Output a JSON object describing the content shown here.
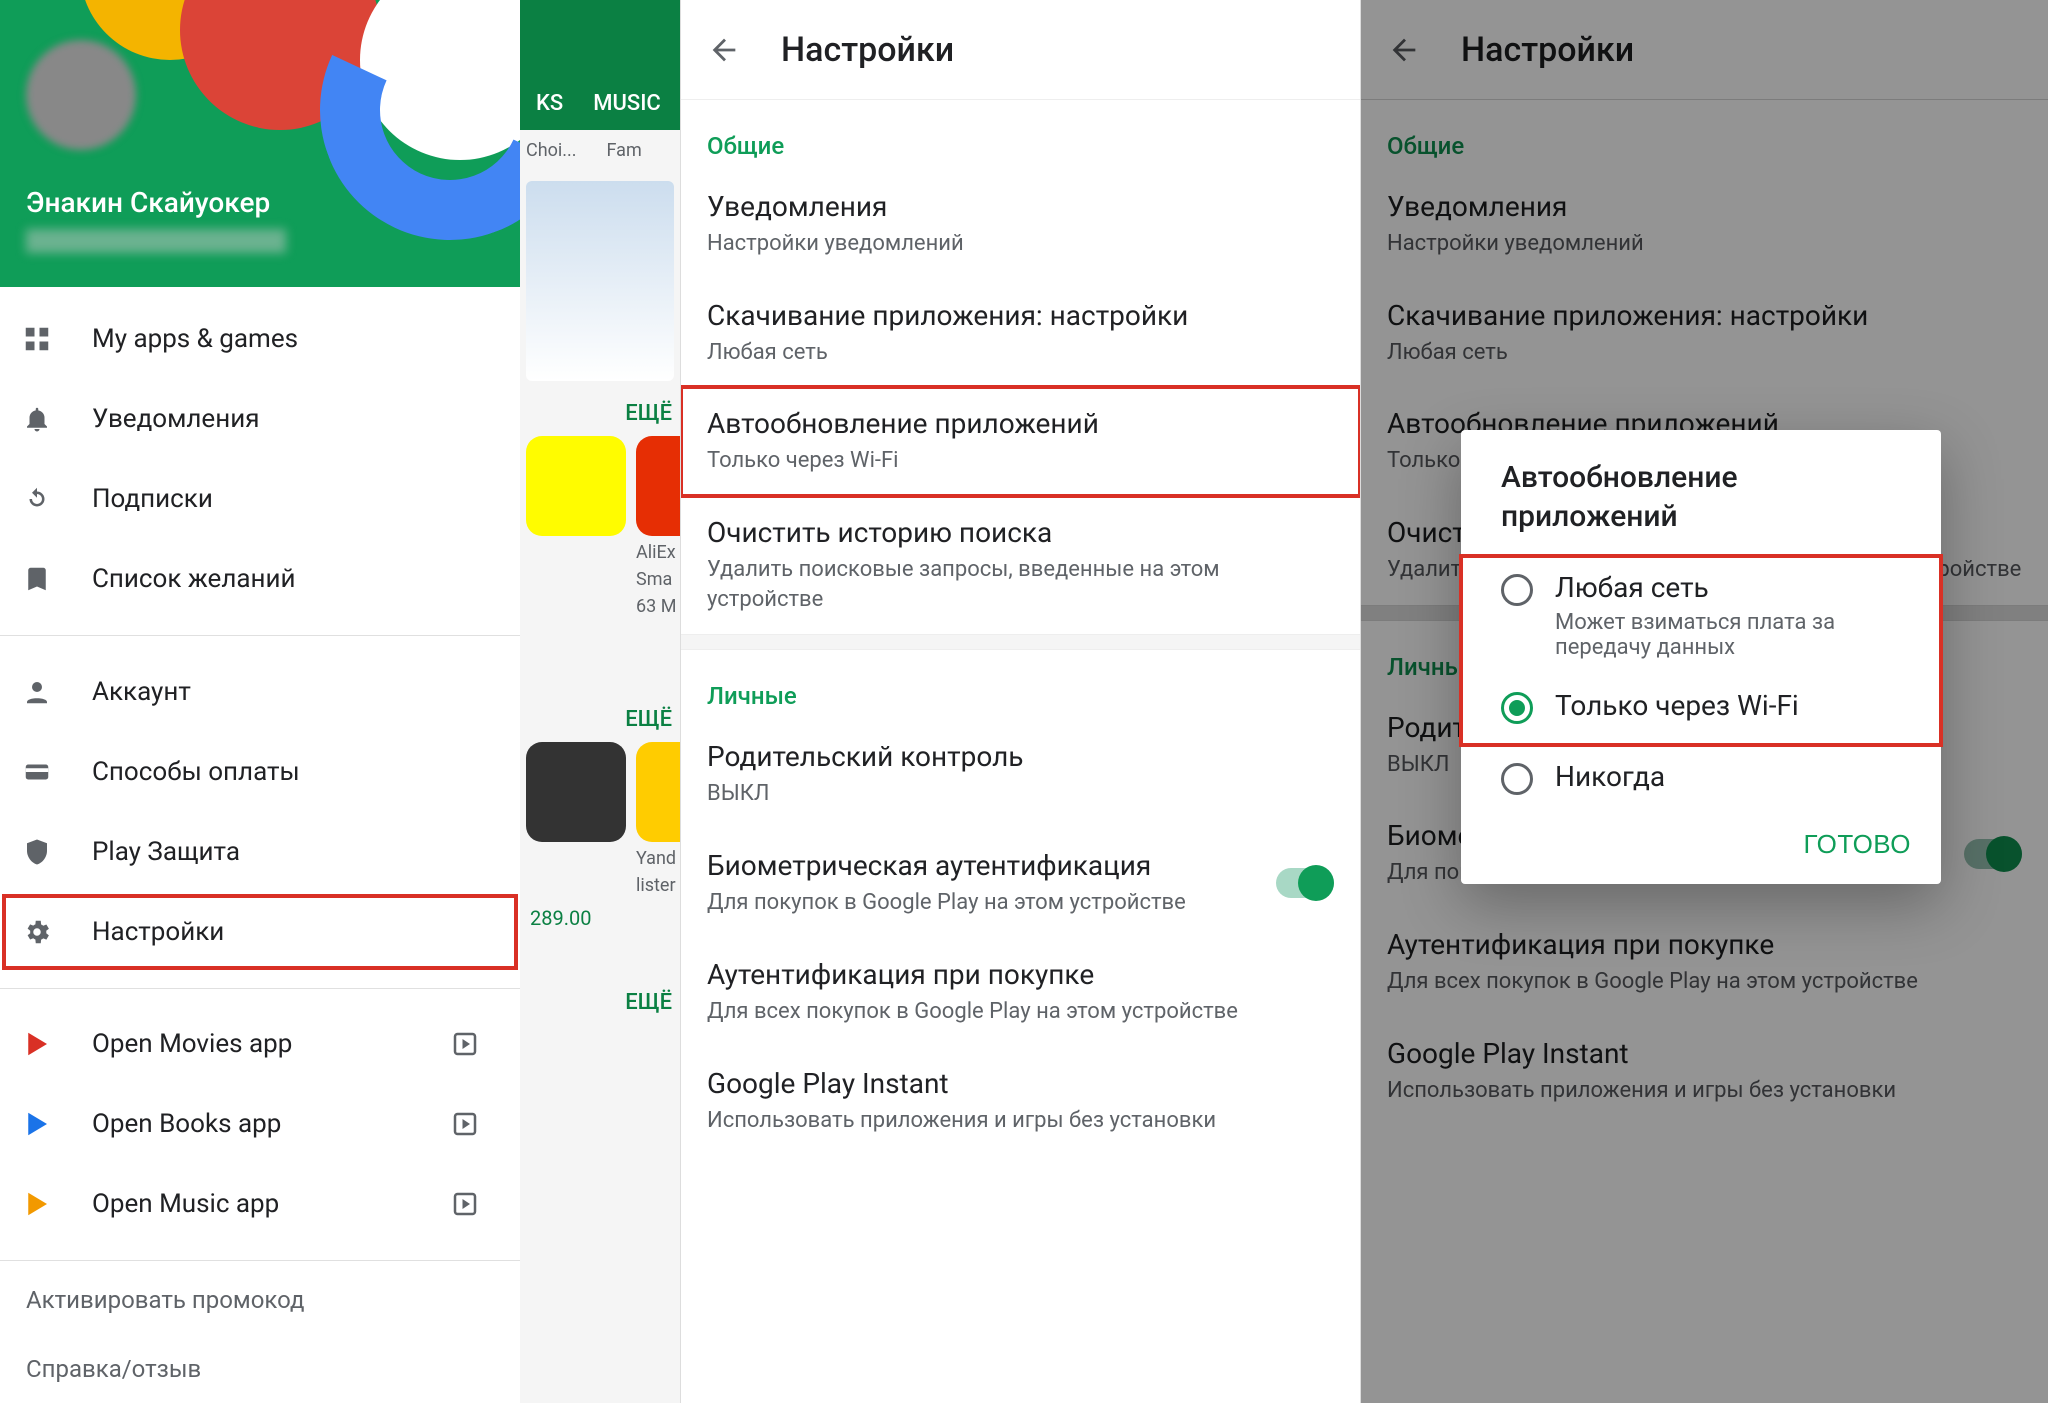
{
  "panel_a": {
    "user": {
      "name": "Энакин Скайуокер"
    },
    "nav_primary": [
      {
        "label": "My apps & games",
        "icon": "grid"
      },
      {
        "label": "Уведомления",
        "icon": "bell"
      },
      {
        "label": "Подписки",
        "icon": "refresh"
      },
      {
        "label": "Список желаний",
        "icon": "bookmark"
      }
    ],
    "nav_account": [
      {
        "label": "Аккаунт",
        "icon": "person"
      },
      {
        "label": "Способы оплаты",
        "icon": "card"
      },
      {
        "label": "Play Защита",
        "icon": "shield"
      },
      {
        "label": "Настройки",
        "icon": "gear",
        "highlight": true
      }
    ],
    "nav_open": [
      {
        "label": "Open Movies app",
        "color": "#d93025"
      },
      {
        "label": "Open Books app",
        "color": "#1a73e8"
      },
      {
        "label": "Open Music app",
        "color": "#f29900"
      }
    ],
    "promo": "Активировать промокод",
    "help": "Справка/отзыв",
    "play_bg": {
      "tabs": [
        "KS",
        "MUSIC"
      ],
      "choi": "Choi...",
      "fam": "Fam",
      "more": "ЕЩЁ",
      "apps": [
        {
          "name": "AliEx",
          "line2": "Sma",
          "line3": "63 M"
        },
        {
          "name": "Yand",
          "line2": "lister"
        }
      ],
      "price": "289.00"
    }
  },
  "settings": {
    "title": "Настройки",
    "section_general": "Общие",
    "rows_general": [
      {
        "title": "Уведомления",
        "sub": "Настройки уведомлений"
      },
      {
        "title": "Скачивание приложения: настройки",
        "sub": "Любая сеть"
      },
      {
        "title": "Автообновление приложений",
        "sub": "Только через Wi-Fi",
        "highlight": true
      },
      {
        "title": "Очистить историю поиска",
        "sub": "Удалить поисковые запросы, введенные на этом устройстве"
      }
    ],
    "section_personal": "Личные",
    "rows_personal": [
      {
        "title": "Родительский контроль",
        "sub": "ВЫКЛ"
      },
      {
        "title": "Биометрическая аутентификация",
        "sub": "Для покупок в Google Play на этом устройстве",
        "toggle": true
      },
      {
        "title": "Аутентификация при покупке",
        "sub": "Для всех покупок в Google Play на этом устройстве"
      },
      {
        "title": "Google Play Instant",
        "sub": "Использовать приложения и игры без установки"
      }
    ]
  },
  "dialog": {
    "title": "Автообновление приложений",
    "options": [
      {
        "label": "Любая сеть",
        "sub": "Может взиматься плата за передачу данных",
        "checked": false
      },
      {
        "label": "Только через Wi-Fi",
        "checked": true
      },
      {
        "label": "Никогда",
        "checked": false
      }
    ],
    "done": "ГОТОВО"
  }
}
